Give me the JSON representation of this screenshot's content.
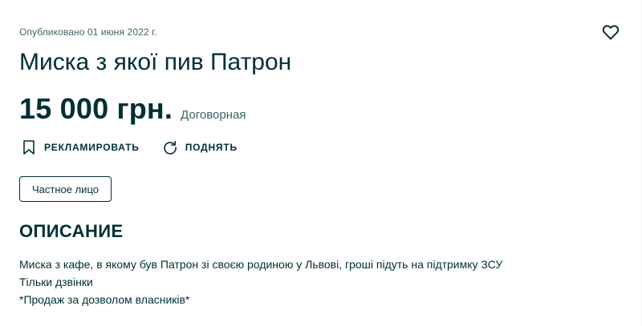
{
  "ad": {
    "published": "Опубликовано 01 июня 2022 г.",
    "title": "Миска з якої пив Патрон",
    "price": "15 000 грн.",
    "price_note": "Договорная"
  },
  "actions": {
    "promote_label": "РЕКЛАМИРОВАТЬ",
    "promote_icon": "bookmark-icon",
    "raise_label": "ПОДНЯТЬ",
    "raise_icon": "refresh-icon",
    "favorite_icon": "heart-icon"
  },
  "seller": {
    "type_label": "Частное лицо"
  },
  "description": {
    "heading": "ОПИСАНИЕ",
    "lines": [
      "Миска з кафе, в якому був Патрон зі своєю родиною у Львові, гроші підуть на підтримку ЗСУ",
      "Тільки дзвінки",
      "*Продаж за дозволом власників*"
    ]
  },
  "colors": {
    "text_primary": "#002f34",
    "text_secondary": "#406367",
    "background": "#ffffff"
  }
}
